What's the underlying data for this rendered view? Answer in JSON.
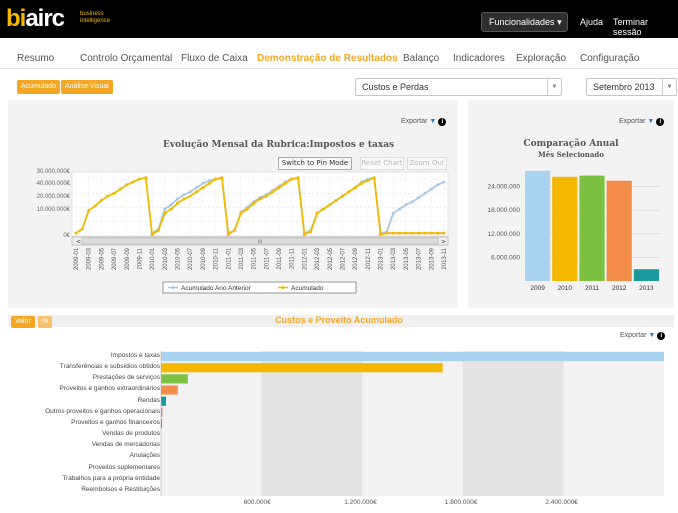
{
  "header": {
    "logo_bi": "bi",
    "logo_rest": "airc",
    "logo_sub1": "business",
    "logo_sub2": "intelligence",
    "functionalities": "Funcionalidades",
    "help": "Ajuda",
    "logout": "Terminar sessão"
  },
  "nav": {
    "items": [
      "Resumo",
      "Controlo Orçamental",
      "Fluxo de Caixa",
      "Demonstração de Resultados",
      "Balanço",
      "Indicadores",
      "Exploração",
      "Configuração"
    ],
    "active_index": 3
  },
  "toolbar": {
    "acumulado": "Acumulado",
    "analise_visual": "Análise Visual",
    "category_select": "Custos e Perdas",
    "month_select": "Setembro 2013"
  },
  "export_label": "Exportar",
  "info_icon": "i",
  "accent_color": "#f5a623",
  "line_chart": {
    "buttons": {
      "pin": "Switch to Pin Mode",
      "reset": "Reset Chart",
      "zoom": "Zoom Out"
    },
    "chart_data": {
      "type": "line",
      "title": "Evolução Mensal da Rubrica:Impostos e taxas",
      "yticks": [
        "30.000.000€",
        "40.000.000€",
        "20.000.000€",
        "10.000.000€",
        "0€"
      ],
      "ylim": [
        0,
        45000000
      ],
      "x": [
        "2009-01",
        "2009-02",
        "2009-03",
        "2009-04",
        "2009-05",
        "2009-06",
        "2009-07",
        "2009-08",
        "2009-09",
        "2009-10",
        "2009-11",
        "2009-12",
        "2010-01",
        "2010-02",
        "2010-03",
        "2010-04",
        "2010-05",
        "2010-06",
        "2010-07",
        "2010-08",
        "2010-09",
        "2010-10",
        "2010-11",
        "2010-12",
        "2011-01",
        "2011-02",
        "2011-03",
        "2011-04",
        "2011-05",
        "2011-06",
        "2011-07",
        "2011-08",
        "2011-09",
        "2011-10",
        "2011-11",
        "2011-12",
        "2012-01",
        "2012-02",
        "2012-03",
        "2012-04",
        "2012-05",
        "2012-06",
        "2012-07",
        "2012-08",
        "2012-09",
        "2012-10",
        "2012-11",
        "2012-12",
        "2013-01",
        "2013-02",
        "2013-03",
        "2013-04",
        "2013-05",
        "2013-06",
        "2013-07",
        "2013-08",
        "2013-09",
        "2013-10",
        "2013-11"
      ],
      "xtick_labels": [
        "2009-01",
        "2009-03",
        "2009-05",
        "2009-07",
        "2009-09",
        "2009-11",
        "2010-01",
        "2010-03",
        "2010-05",
        "2010-07",
        "2010-09",
        "2010-11",
        "2011-01",
        "2011-03",
        "2011-05",
        "2011-07",
        "2011-09",
        "2011-11",
        "2012-01",
        "2012-03",
        "2012-05",
        "2012-07",
        "2012-09",
        "2012-11",
        "2013-01",
        "2013-03",
        "2013-05",
        "2013-07",
        "2013-09",
        "2013-11"
      ],
      "series": [
        {
          "name": "Acumulado Ano Anterior",
          "color": "#a9c8e8",
          "values": [
            null,
            null,
            null,
            null,
            null,
            null,
            null,
            null,
            null,
            null,
            null,
            null,
            2000000,
            5000000,
            19000000,
            22000000,
            26000000,
            29000000,
            31000000,
            34000000,
            37000000,
            39000000,
            40000000,
            41000000,
            2000000,
            4000000,
            17000000,
            20000000,
            24000000,
            27000000,
            29000000,
            32000000,
            35000000,
            38000000,
            40000000,
            41000000,
            2000000,
            4000000,
            16000000,
            19000000,
            22000000,
            25000000,
            28000000,
            31000000,
            34000000,
            38000000,
            40000000,
            41000000,
            2000000,
            3000000,
            16000000,
            19000000,
            22000000,
            24000000,
            27000000,
            30000000,
            33000000,
            36000000,
            38000000
          ]
        },
        {
          "name": "Acumulado",
          "color": "#f5b800",
          "values": [
            2000000,
            5000000,
            18000000,
            21000000,
            25000000,
            28000000,
            30000000,
            33000000,
            36000000,
            38000000,
            40000000,
            41000000,
            1000000,
            4000000,
            16000000,
            19000000,
            23000000,
            26000000,
            28000000,
            31000000,
            34000000,
            37000000,
            40000000,
            41000000,
            1000000,
            4000000,
            16000000,
            19000000,
            23000000,
            26000000,
            28000000,
            31000000,
            34000000,
            37000000,
            40000000,
            41000000,
            1000000,
            3000000,
            16000000,
            19000000,
            22000000,
            25000000,
            28000000,
            31000000,
            34000000,
            37000000,
            39000000,
            41000000,
            1000000,
            2000000,
            2000000,
            2000000,
            2000000,
            2000000,
            2000000,
            2000000,
            2000000,
            2000000,
            2000000
          ]
        }
      ],
      "scrollbar_label": "III"
    }
  },
  "bar_chart": {
    "chart_data": {
      "type": "bar",
      "title": "Comparação Anual",
      "subtitle": "Mês Selecionado",
      "categories": [
        "2009",
        "2010",
        "2011",
        "2012",
        "2013"
      ],
      "values": [
        28000000,
        26500000,
        26800000,
        25500000,
        3000000
      ],
      "colors": [
        "#a9d3ee",
        "#f5b800",
        "#7cc142",
        "#f58d4a",
        "#1a9a9a"
      ],
      "yticks": [
        "24.000.000",
        "18.000.000",
        "12.000.000",
        "6.000.000"
      ],
      "ylim": [
        0,
        30000000
      ]
    }
  },
  "hbar_chart": {
    "toggle_valor": "Valor",
    "toggle_pct": "%",
    "chart_data": {
      "type": "bar",
      "title": "Custos e Proveito Acumulado",
      "categories": [
        "Impostos e taxas",
        "Transferências e subsídios obtidos",
        "Prestações de serviços",
        "Proveitos e ganhos extraordinários",
        "Rendas",
        "Outros proveitos e ganhos operacionais",
        "Proveitos e ganhos financeiros",
        "Vendas de produtos",
        "Vendas de mercadorias",
        "Anulações",
        "Proveitos suplementares",
        "Trabalhos para a própria entidade",
        "Reembolsos e Restituições"
      ],
      "values": [
        3000000,
        1680000,
        160000,
        100000,
        30000,
        8000,
        6000,
        0,
        0,
        0,
        0,
        0,
        0
      ],
      "colors": [
        "#a9d3ee",
        "#f5b800",
        "#7cc142",
        "#f58d4a",
        "#1a9a9a",
        "#e07070",
        "#9b59b6",
        "#888888",
        "#888888",
        "#888888",
        "#888888",
        "#888888",
        "#888888"
      ],
      "xticks": [
        "600.000€",
        "1.200.000€",
        "1.800.000€",
        "2.400.000€"
      ],
      "xlim": [
        0,
        3000000
      ]
    }
  }
}
